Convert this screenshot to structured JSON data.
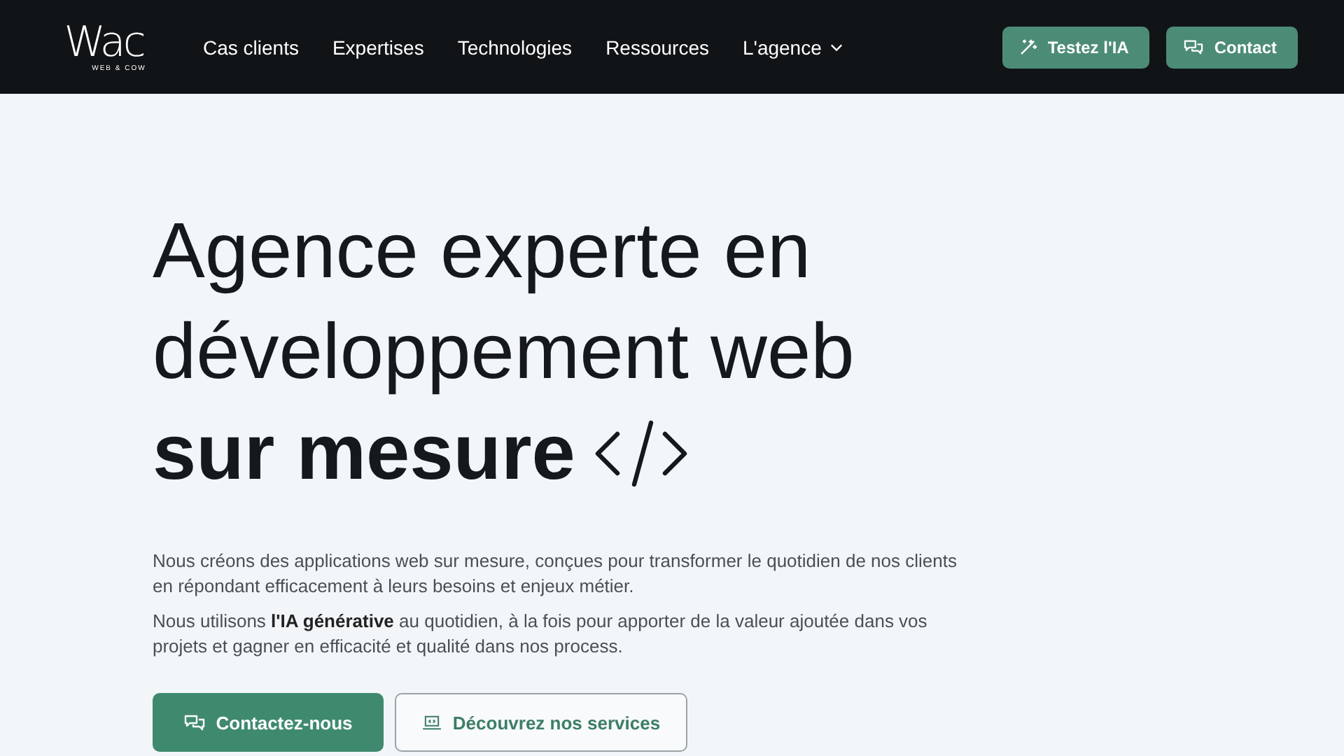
{
  "header": {
    "logo": {
      "wordmark": "Wac",
      "tagline": "WEB & COW"
    },
    "nav": [
      {
        "label": "Cas clients",
        "has_dropdown": false
      },
      {
        "label": "Expertises",
        "has_dropdown": false
      },
      {
        "label": "Technologies",
        "has_dropdown": false
      },
      {
        "label": "Ressources",
        "has_dropdown": false
      },
      {
        "label": "L'agence",
        "has_dropdown": true
      }
    ],
    "actions": [
      {
        "label": "Testez l'IA",
        "kind": "wand"
      },
      {
        "label": "Contact",
        "kind": "chat"
      }
    ]
  },
  "hero": {
    "title_lines": [
      {
        "text": "Agence experte en",
        "bold": false
      },
      {
        "text": "développement web",
        "bold": false
      },
      {
        "text": "sur mesure",
        "bold": true
      }
    ],
    "paragraphs": [
      "Nous créons des applications web sur mesure, conçues pour transformer le quotidien de nos clients en répondant efficacement à leurs besoins et enjeux métier.",
      "Nous utilisons **l'IA générative** au quotidien, à la fois pour apporter de la valeur ajoutée dans vos projets et gagner en efficacité et qualité dans nos process."
    ],
    "buttons": [
      {
        "label": "Contactez-nous",
        "kind": "primary"
      },
      {
        "label": "Découvrez nos services",
        "kind": "secondary"
      }
    ]
  }
}
